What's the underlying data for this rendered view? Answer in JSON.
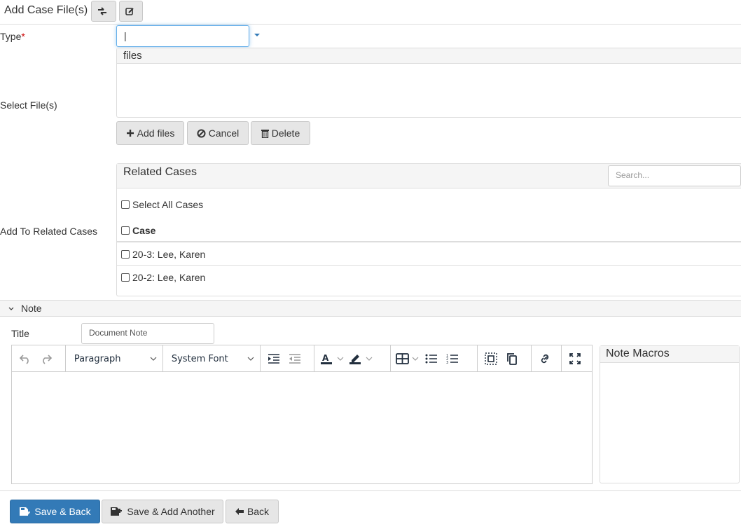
{
  "header": {
    "title": "Add Case File(s)",
    "buttons": [
      {
        "icon": "swap-icon"
      },
      {
        "icon": "edit-icon"
      }
    ]
  },
  "form": {
    "type": {
      "label": "Type",
      "required_mark": "*",
      "value": "|"
    },
    "select_files": {
      "label": "Select File(s)",
      "panel_header": "files",
      "buttons": {
        "add": "Add files",
        "cancel": "Cancel",
        "delete": "Delete"
      }
    },
    "related_cases": {
      "label": "Add To Related Cases",
      "panel_title": "Related Cases",
      "search_placeholder": "Search...",
      "select_all_label": "Select All Cases",
      "column_header": "Case",
      "rows": [
        {
          "label": "20-3: Lee, Karen",
          "checked": false
        },
        {
          "label": "20-2: Lee, Karen",
          "checked": false
        }
      ]
    }
  },
  "note": {
    "section_label": "Note",
    "title_label": "Title",
    "title_placeholder": "Document Note",
    "editor": {
      "block_format": "Paragraph",
      "font_family": "System Font"
    },
    "macros_title": "Note Macros"
  },
  "footer": {
    "save_back": "Save & Back",
    "save_add_another": "Save & Add Another",
    "back": "Back"
  },
  "colors": {
    "primary": "#337ab7",
    "required": "#cc0000",
    "focus": "#66afe9"
  }
}
